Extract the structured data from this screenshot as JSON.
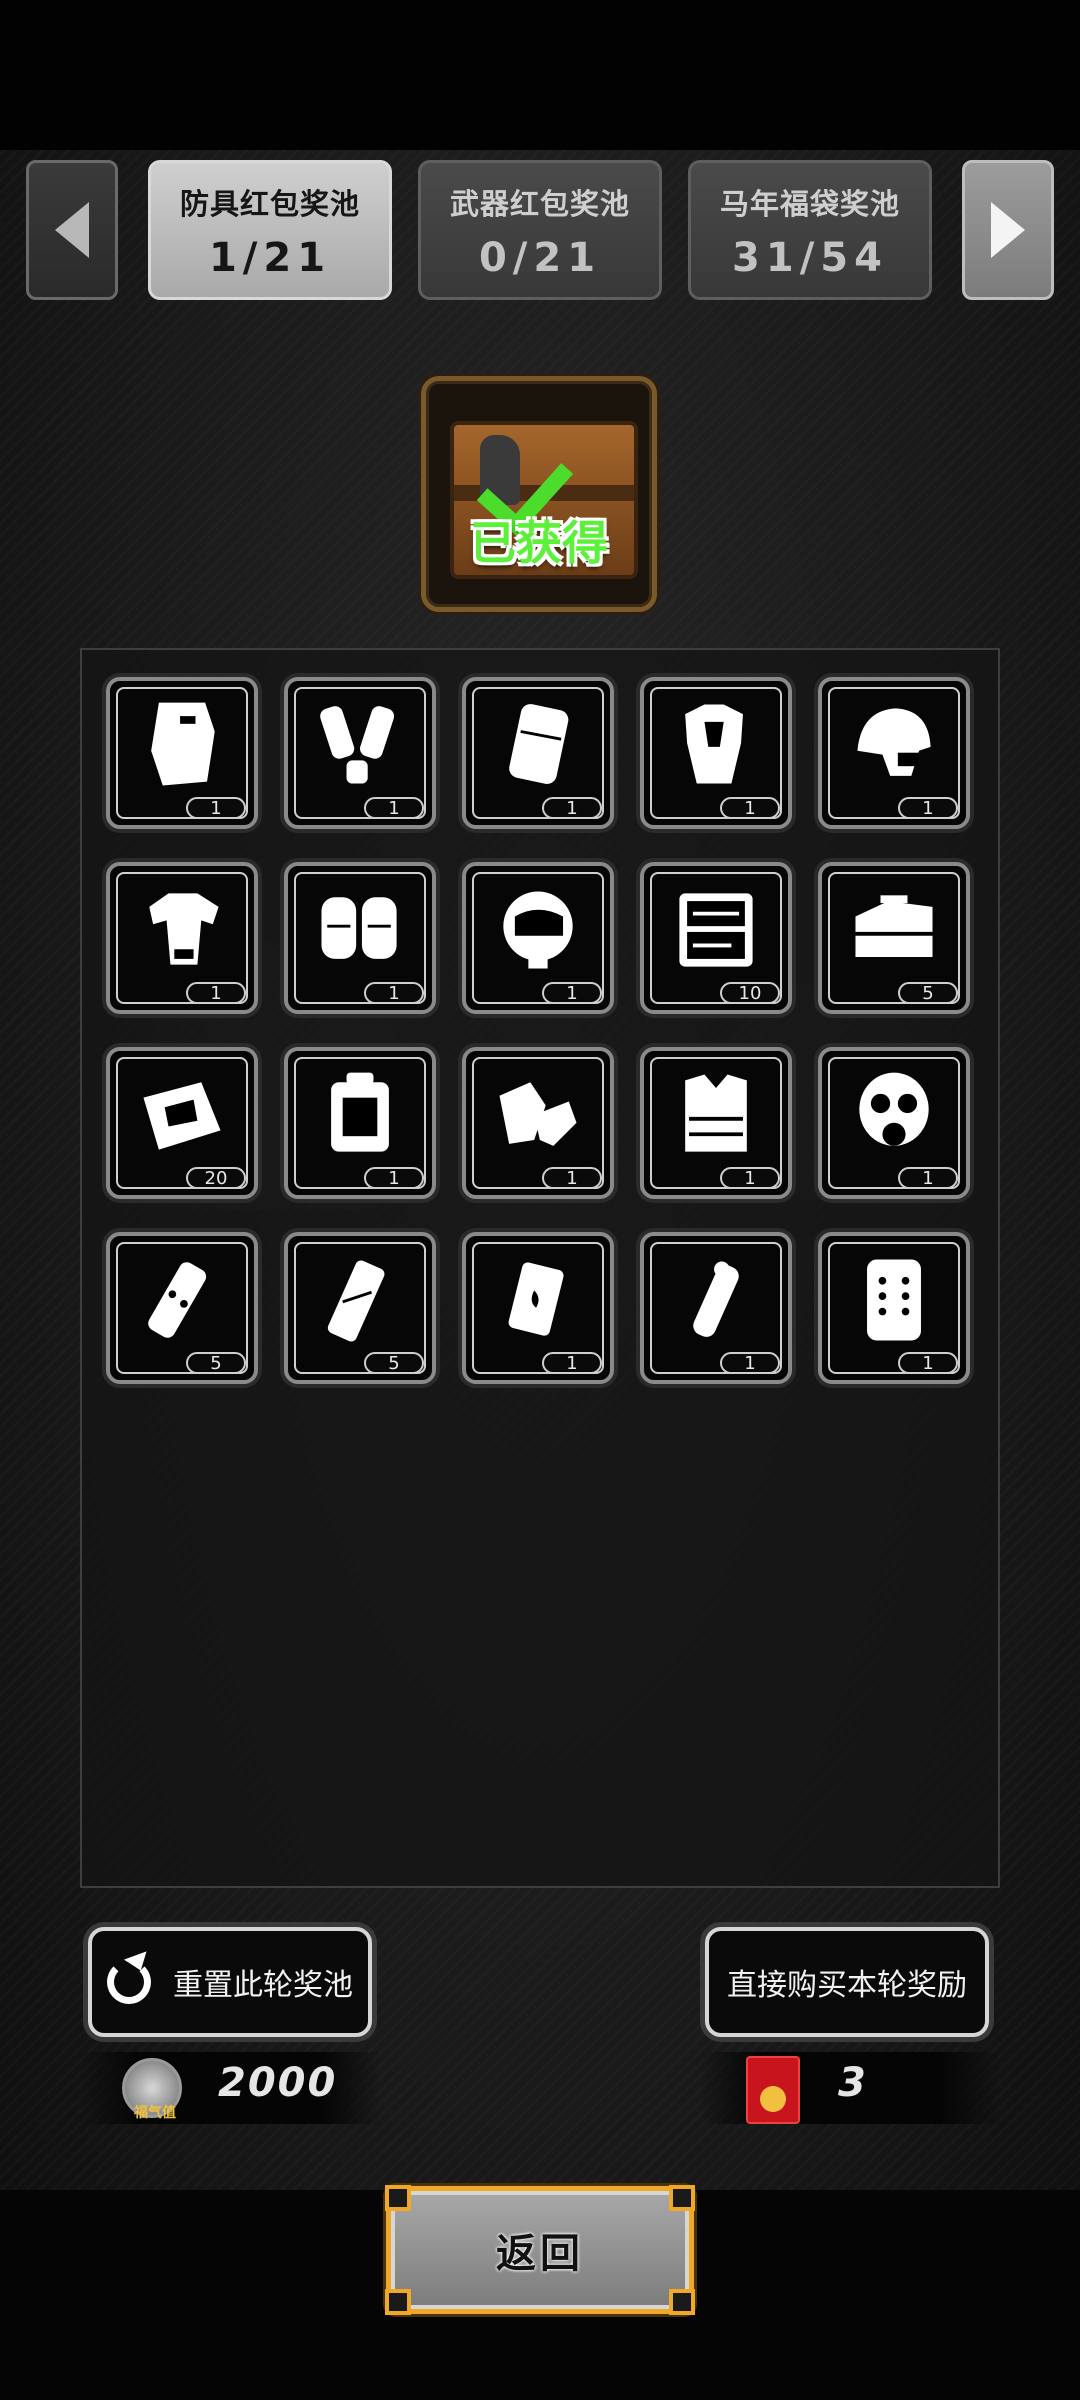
{
  "tabs": [
    {
      "title": "防具红包奖池",
      "count": "1/21",
      "active": true
    },
    {
      "title": "武器红包奖池",
      "count": "0/21",
      "active": false
    },
    {
      "title": "马年福袋奖池",
      "count": "31/54",
      "active": false
    }
  ],
  "reward": {
    "status_label": "已获得"
  },
  "items": [
    {
      "icon": "riot-shield-icon",
      "qty": "1"
    },
    {
      "icon": "arm-guards-icon",
      "qty": "1"
    },
    {
      "icon": "leg-pad-icon",
      "qty": "1"
    },
    {
      "icon": "body-armor-icon",
      "qty": "1"
    },
    {
      "icon": "tactical-helmet-icon",
      "qty": "1"
    },
    {
      "icon": "shoulder-armor-icon",
      "qty": "1"
    },
    {
      "icon": "knee-pads-icon",
      "qty": "1"
    },
    {
      "icon": "visor-helmet-icon",
      "qty": "1"
    },
    {
      "icon": "tool-case-icon",
      "qty": "10"
    },
    {
      "icon": "toolbox-icon",
      "qty": "5"
    },
    {
      "icon": "repair-kit-icon",
      "qty": "20"
    },
    {
      "icon": "backpack-icon",
      "qty": "1"
    },
    {
      "icon": "gloves-icon",
      "qty": "1"
    },
    {
      "icon": "tactical-vest-icon",
      "qty": "1"
    },
    {
      "icon": "gas-mask-icon",
      "qty": "1"
    },
    {
      "icon": "flashbang-icon",
      "qty": "5"
    },
    {
      "icon": "smoke-grenade-icon",
      "qty": "5"
    },
    {
      "icon": "incendiary-grenade-icon",
      "qty": "1"
    },
    {
      "icon": "stun-grenade-icon",
      "qty": "1"
    },
    {
      "icon": "ballistic-shield-icon",
      "qty": "1"
    }
  ],
  "actions": {
    "reset_label": "重置此轮奖池",
    "buy_label": "直接购买本轮奖励"
  },
  "currency": {
    "luck_label": "福气值",
    "luck_value": "2000",
    "envelope_value": "3"
  },
  "return_label": "返回",
  "colors": {
    "accent_gold": "#f0a828",
    "check_green": "#4cdc2c",
    "envelope_red": "#c8141c"
  }
}
